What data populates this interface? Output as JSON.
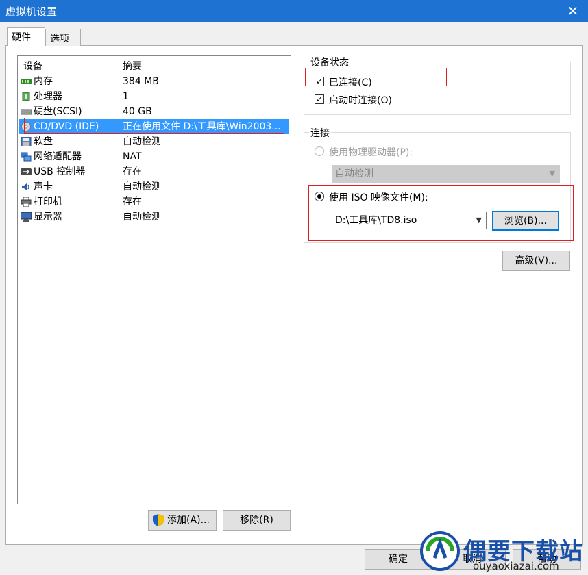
{
  "window": {
    "title": "虚拟机设置"
  },
  "tabs": [
    {
      "label": "硬件",
      "active": true
    },
    {
      "label": "选项",
      "active": false
    }
  ],
  "device_list": {
    "columns": [
      "设备",
      "摘要"
    ],
    "rows": [
      {
        "name": "内存",
        "summary": "384 MB",
        "icon": "memory-icon"
      },
      {
        "name": "处理器",
        "summary": "1",
        "icon": "processor-icon"
      },
      {
        "name": "硬盘(SCSI)",
        "summary": "40 GB",
        "icon": "harddisk-icon"
      },
      {
        "name": "CD/DVD (IDE)",
        "summary": "正在使用文件 D:\\工具库\\Win2003...",
        "icon": "cd-dvd-icon",
        "selected": true
      },
      {
        "name": "软盘",
        "summary": "自动检测",
        "icon": "floppy-icon"
      },
      {
        "name": "网络适配器",
        "summary": "NAT",
        "icon": "network-icon"
      },
      {
        "name": "USB 控制器",
        "summary": "存在",
        "icon": "usb-icon"
      },
      {
        "name": "声卡",
        "summary": "自动检测",
        "icon": "sound-icon"
      },
      {
        "name": "打印机",
        "summary": "存在",
        "icon": "printer-icon"
      },
      {
        "name": "显示器",
        "summary": "自动检测",
        "icon": "display-icon"
      }
    ],
    "add_label": "添加(A)...",
    "remove_label": "移除(R)"
  },
  "device_status": {
    "title": "设备状态",
    "connected_label": "已连接(C)",
    "connected": true,
    "connect_at_power_on_label": "启动时连接(O)",
    "connect_at_power_on": true
  },
  "connection": {
    "title": "连接",
    "physical_label": "使用物理驱动器(P):",
    "physical_value": "自动检测",
    "iso_label": "使用 ISO 映像文件(M):",
    "iso_value": "D:\\工具库\\TD8.iso",
    "browse_label": "浏览(B)..."
  },
  "advanced_label": "高级(V)...",
  "footer": {
    "ok_label": "确定",
    "cancel_label": "取消",
    "help_label": "帮助"
  },
  "watermark": {
    "brand": "偶要下载站",
    "url": "ouyaoxiazai.com"
  }
}
